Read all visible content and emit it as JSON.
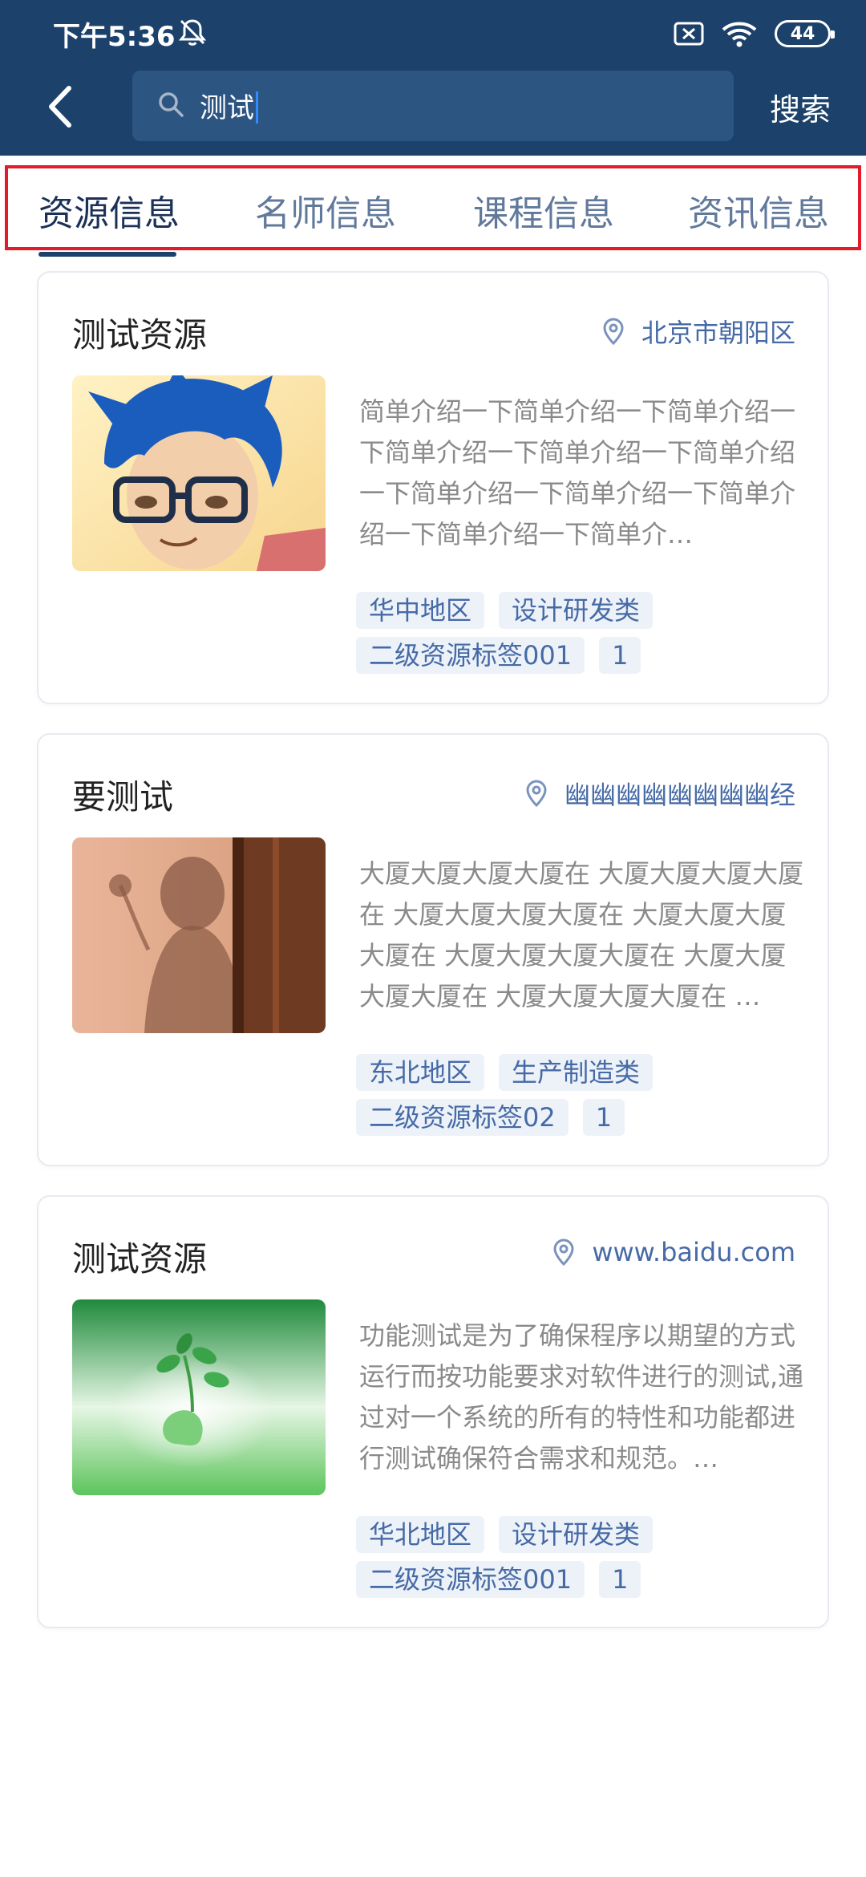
{
  "status": {
    "time": "下午5:36",
    "battery": "44"
  },
  "header": {
    "search_query": "测试",
    "search_button": "搜索"
  },
  "tabs": [
    {
      "label": "资源信息",
      "active": true
    },
    {
      "label": "名师信息",
      "active": false
    },
    {
      "label": "课程信息",
      "active": false
    },
    {
      "label": "资讯信息",
      "active": false
    }
  ],
  "cards": [
    {
      "title": "测试资源",
      "location": "北京市朝阳区",
      "description": "简单介绍一下简单介绍一下简单介绍一下简单介绍一下简单介绍一下简单介绍一下简单介绍一下简单介绍一下简单介绍一下简单介绍一下简单介…",
      "tags_row1": [
        "华中地区",
        "设计研发类"
      ],
      "tags_row2": [
        "二级资源标签001",
        "1"
      ],
      "image": "cartoon-avatar"
    },
    {
      "title": "要测试",
      "location": "幽幽幽幽幽幽幽幽经",
      "description": " 大厦大厦大厦大厦在 大厦大厦大厦大厦在 大厦大厦大厦大厦在 大厦大厦大厦大厦在 大厦大厦大厦大厦在 大厦大厦大厦大厦在 大厦大厦大厦大厦在 …",
      "tags_row1": [
        "东北地区",
        "生产制造类"
      ],
      "tags_row2": [
        "二级资源标签02",
        "1"
      ],
      "image": "shadow-photo"
    },
    {
      "title": "测试资源",
      "location": "www.baidu.com",
      "description": "功能测试是为了确保程序以期望的方式运行而按功能要求对软件进行的测试,通过对一个系统的所有的特性和功能都进行测试确保符合需求和规范。…",
      "tags_row1": [
        "华北地区",
        "设计研发类"
      ],
      "tags_row2": [
        "二级资源标签001",
        "1"
      ],
      "image": "green-plant"
    }
  ]
}
